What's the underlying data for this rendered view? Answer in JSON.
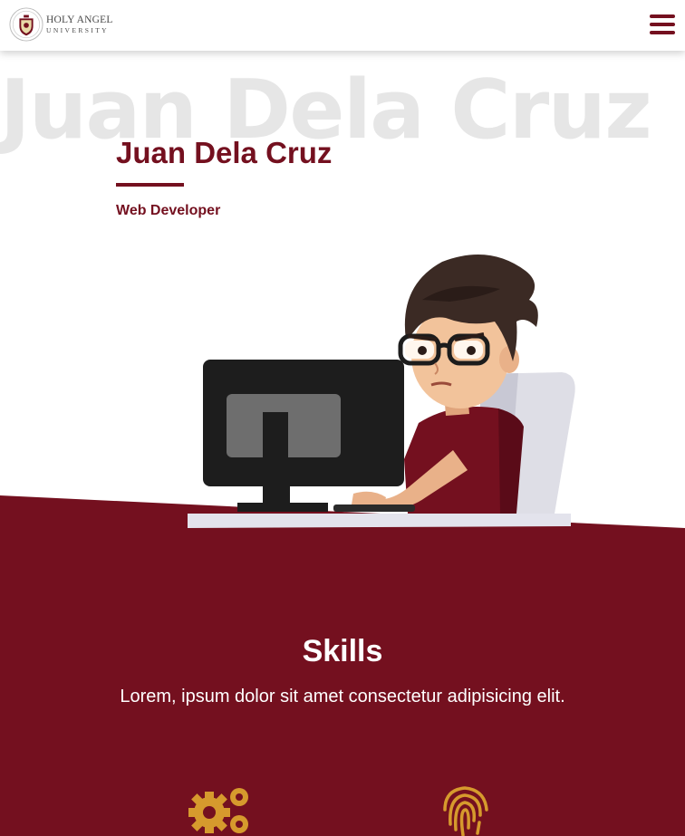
{
  "header": {
    "logo": {
      "line1": "HOLY ANGEL",
      "line2": "UNIVERSITY",
      "icon": "university-seal-icon"
    },
    "menu_icon": "hamburger-menu-icon"
  },
  "hero": {
    "background_name": "Juan Dela Cruz",
    "name": "Juan Dela Cruz",
    "role": "Web Developer",
    "illustration": "developer-at-computer-illustration"
  },
  "skills": {
    "title": "Skills",
    "description": "Lorem, ipsum dolor sit amet consectetur adipisicing elit.",
    "items": [
      {
        "icon": "gears-icon"
      },
      {
        "icon": "fingerprint-icon"
      }
    ]
  },
  "colors": {
    "primary": "#74101f",
    "accent": "#d69a2d",
    "background_text": "#e6e6e6",
    "white": "#ffffff"
  }
}
